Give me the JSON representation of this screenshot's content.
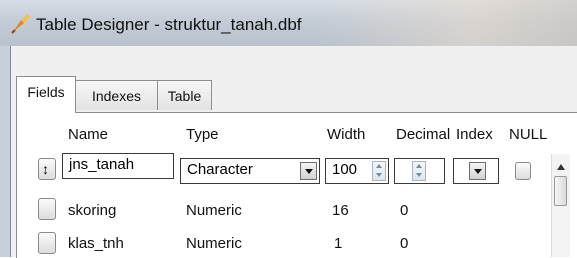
{
  "window": {
    "title": "Table Designer - struktur_tanah.dbf",
    "icon": "table-designer-icon"
  },
  "tabs": [
    {
      "label": "Fields",
      "active": true
    },
    {
      "label": "Indexes",
      "active": false
    },
    {
      "label": "Table",
      "active": false
    }
  ],
  "columns": {
    "name": "Name",
    "type": "Type",
    "width": "Width",
    "decimal": "Decimal",
    "index": "Index",
    "null": "NULL"
  },
  "rows": [
    {
      "name": "jns_tanah",
      "type": "Character",
      "width": "100",
      "decimal": "",
      "editing": true
    },
    {
      "name": "skoring",
      "type": "Numeric",
      "width": "16",
      "decimal": "0"
    },
    {
      "name": "klas_tnh",
      "type": "Numeric",
      "width": "1",
      "decimal": "0"
    }
  ],
  "colors": {
    "titlebar": "#c4ccd6",
    "panel": "#ffffff",
    "client": "#f0f0f0"
  }
}
